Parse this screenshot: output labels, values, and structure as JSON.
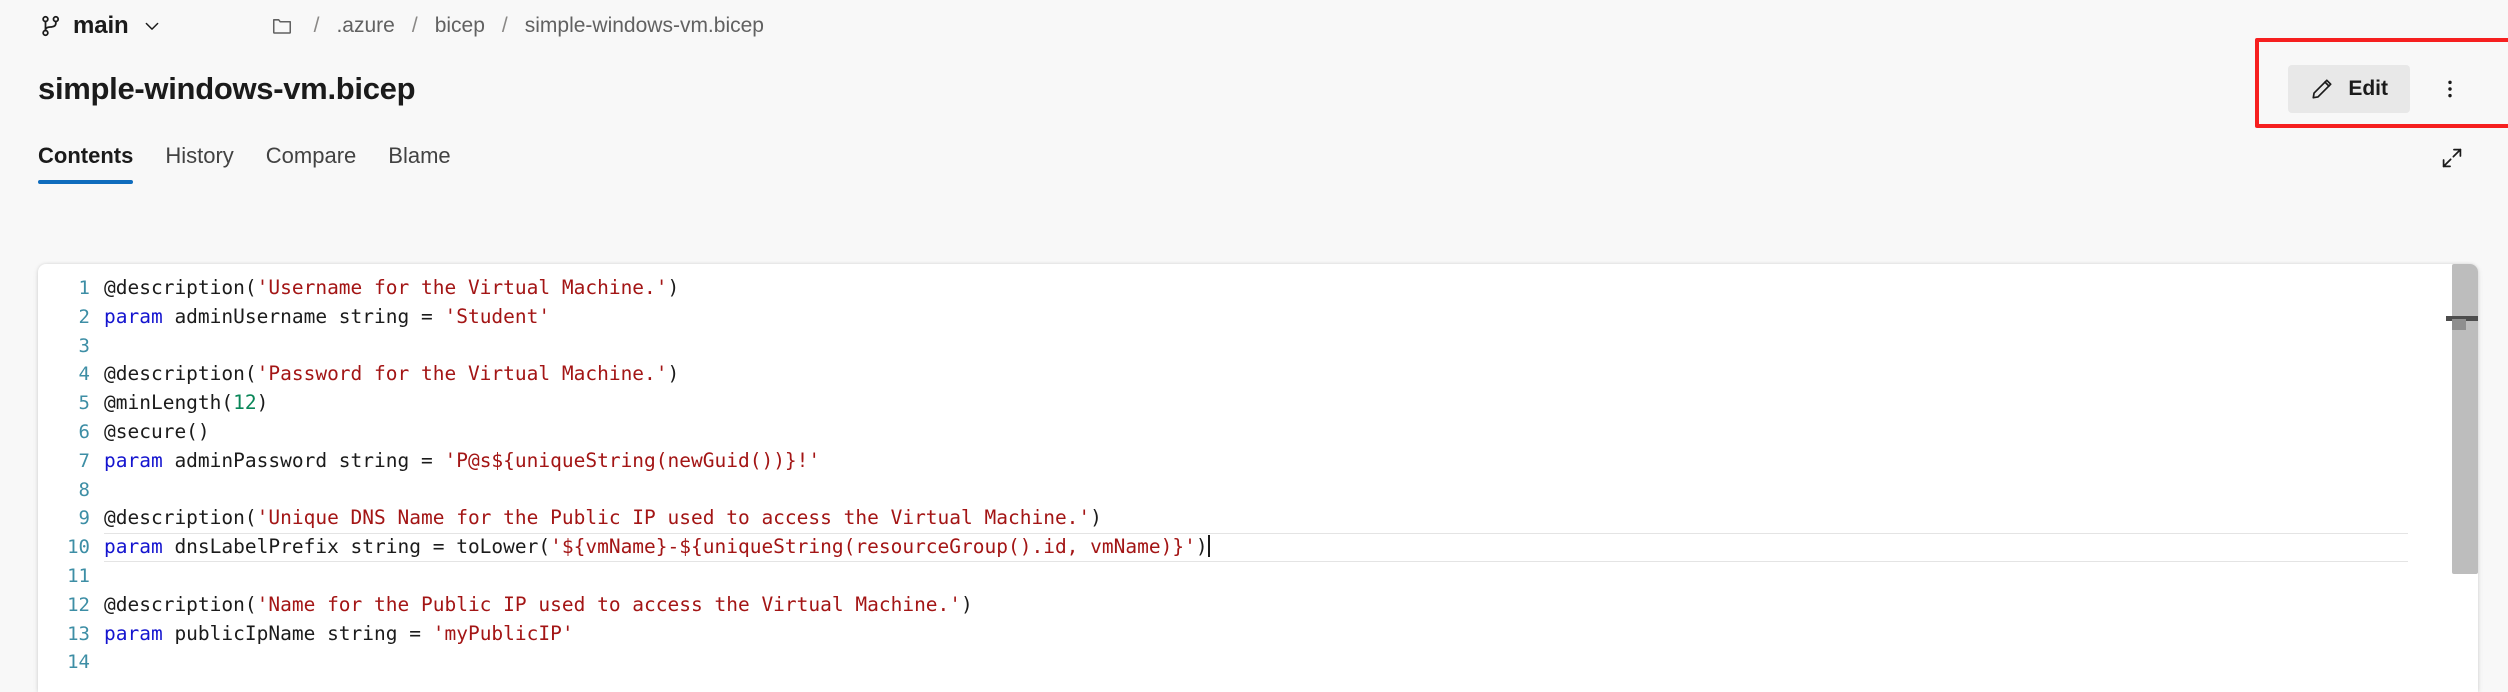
{
  "branch": {
    "name": "main",
    "icon": "git-branch-icon",
    "chevron": "chevron-down-icon"
  },
  "breadcrumb": {
    "folder_icon": "folder-icon",
    "separator": "/",
    "items": [
      {
        "label": ".azure"
      },
      {
        "label": "bicep"
      },
      {
        "label": "simple-windows-vm.bicep"
      }
    ]
  },
  "header": {
    "title": "simple-windows-vm.bicep",
    "edit_label": "Edit",
    "edit_icon": "pencil-icon",
    "more_icon": "more-vertical-icon",
    "expand_icon": "expand-diagonal-icon",
    "highlight_color": "#f61f1f"
  },
  "tabs": [
    {
      "label": "Contents",
      "active": true
    },
    {
      "label": "History",
      "active": false
    },
    {
      "label": "Compare",
      "active": false
    },
    {
      "label": "Blame",
      "active": false
    }
  ],
  "editor": {
    "language": "bicep",
    "cursor_line": 10,
    "colors": {
      "keyword": "#1414cf",
      "string": "#a31515",
      "number": "#098658",
      "plain": "#1b1b1b",
      "lineno": "#3d8ea5"
    },
    "lines": [
      {
        "n": "1",
        "tokens": [
          {
            "t": "pln",
            "v": "@description("
          },
          {
            "t": "str",
            "v": "'Username for the Virtual Machine.'"
          },
          {
            "t": "pln",
            "v": ")"
          }
        ]
      },
      {
        "n": "2",
        "tokens": [
          {
            "t": "kw",
            "v": "param"
          },
          {
            "t": "pln",
            "v": " adminUsername string = "
          },
          {
            "t": "str",
            "v": "'Student'"
          }
        ]
      },
      {
        "n": "3",
        "tokens": []
      },
      {
        "n": "4",
        "tokens": [
          {
            "t": "pln",
            "v": "@description("
          },
          {
            "t": "str",
            "v": "'Password for the Virtual Machine.'"
          },
          {
            "t": "pln",
            "v": ")"
          }
        ]
      },
      {
        "n": "5",
        "tokens": [
          {
            "t": "pln",
            "v": "@minLength("
          },
          {
            "t": "num",
            "v": "12"
          },
          {
            "t": "pln",
            "v": ")"
          }
        ]
      },
      {
        "n": "6",
        "tokens": [
          {
            "t": "pln",
            "v": "@secure()"
          }
        ]
      },
      {
        "n": "7",
        "tokens": [
          {
            "t": "kw",
            "v": "param"
          },
          {
            "t": "pln",
            "v": " adminPassword string = "
          },
          {
            "t": "str",
            "v": "'P@s${uniqueString(newGuid())}!'"
          }
        ]
      },
      {
        "n": "8",
        "tokens": []
      },
      {
        "n": "9",
        "tokens": [
          {
            "t": "pln",
            "v": "@description("
          },
          {
            "t": "str",
            "v": "'Unique DNS Name for the Public IP used to access the Virtual Machine.'"
          },
          {
            "t": "pln",
            "v": ")"
          }
        ]
      },
      {
        "n": "10",
        "tokens": [
          {
            "t": "kw",
            "v": "param"
          },
          {
            "t": "pln",
            "v": " dnsLabelPrefix string = toLower("
          },
          {
            "t": "str",
            "v": "'${vmName}-${uniqueString(resourceGroup().id, vmName)}'"
          },
          {
            "t": "pln",
            "v": ")"
          }
        ],
        "cursor": true
      },
      {
        "n": "11",
        "tokens": []
      },
      {
        "n": "12",
        "tokens": [
          {
            "t": "pln",
            "v": "@description("
          },
          {
            "t": "str",
            "v": "'Name for the Public IP used to access the Virtual Machine.'"
          },
          {
            "t": "pln",
            "v": ")"
          }
        ]
      },
      {
        "n": "13",
        "tokens": [
          {
            "t": "kw",
            "v": "param"
          },
          {
            "t": "pln",
            "v": " publicIpName string = "
          },
          {
            "t": "str",
            "v": "'myPublicIP'"
          }
        ]
      },
      {
        "n": "14",
        "tokens": []
      }
    ]
  }
}
